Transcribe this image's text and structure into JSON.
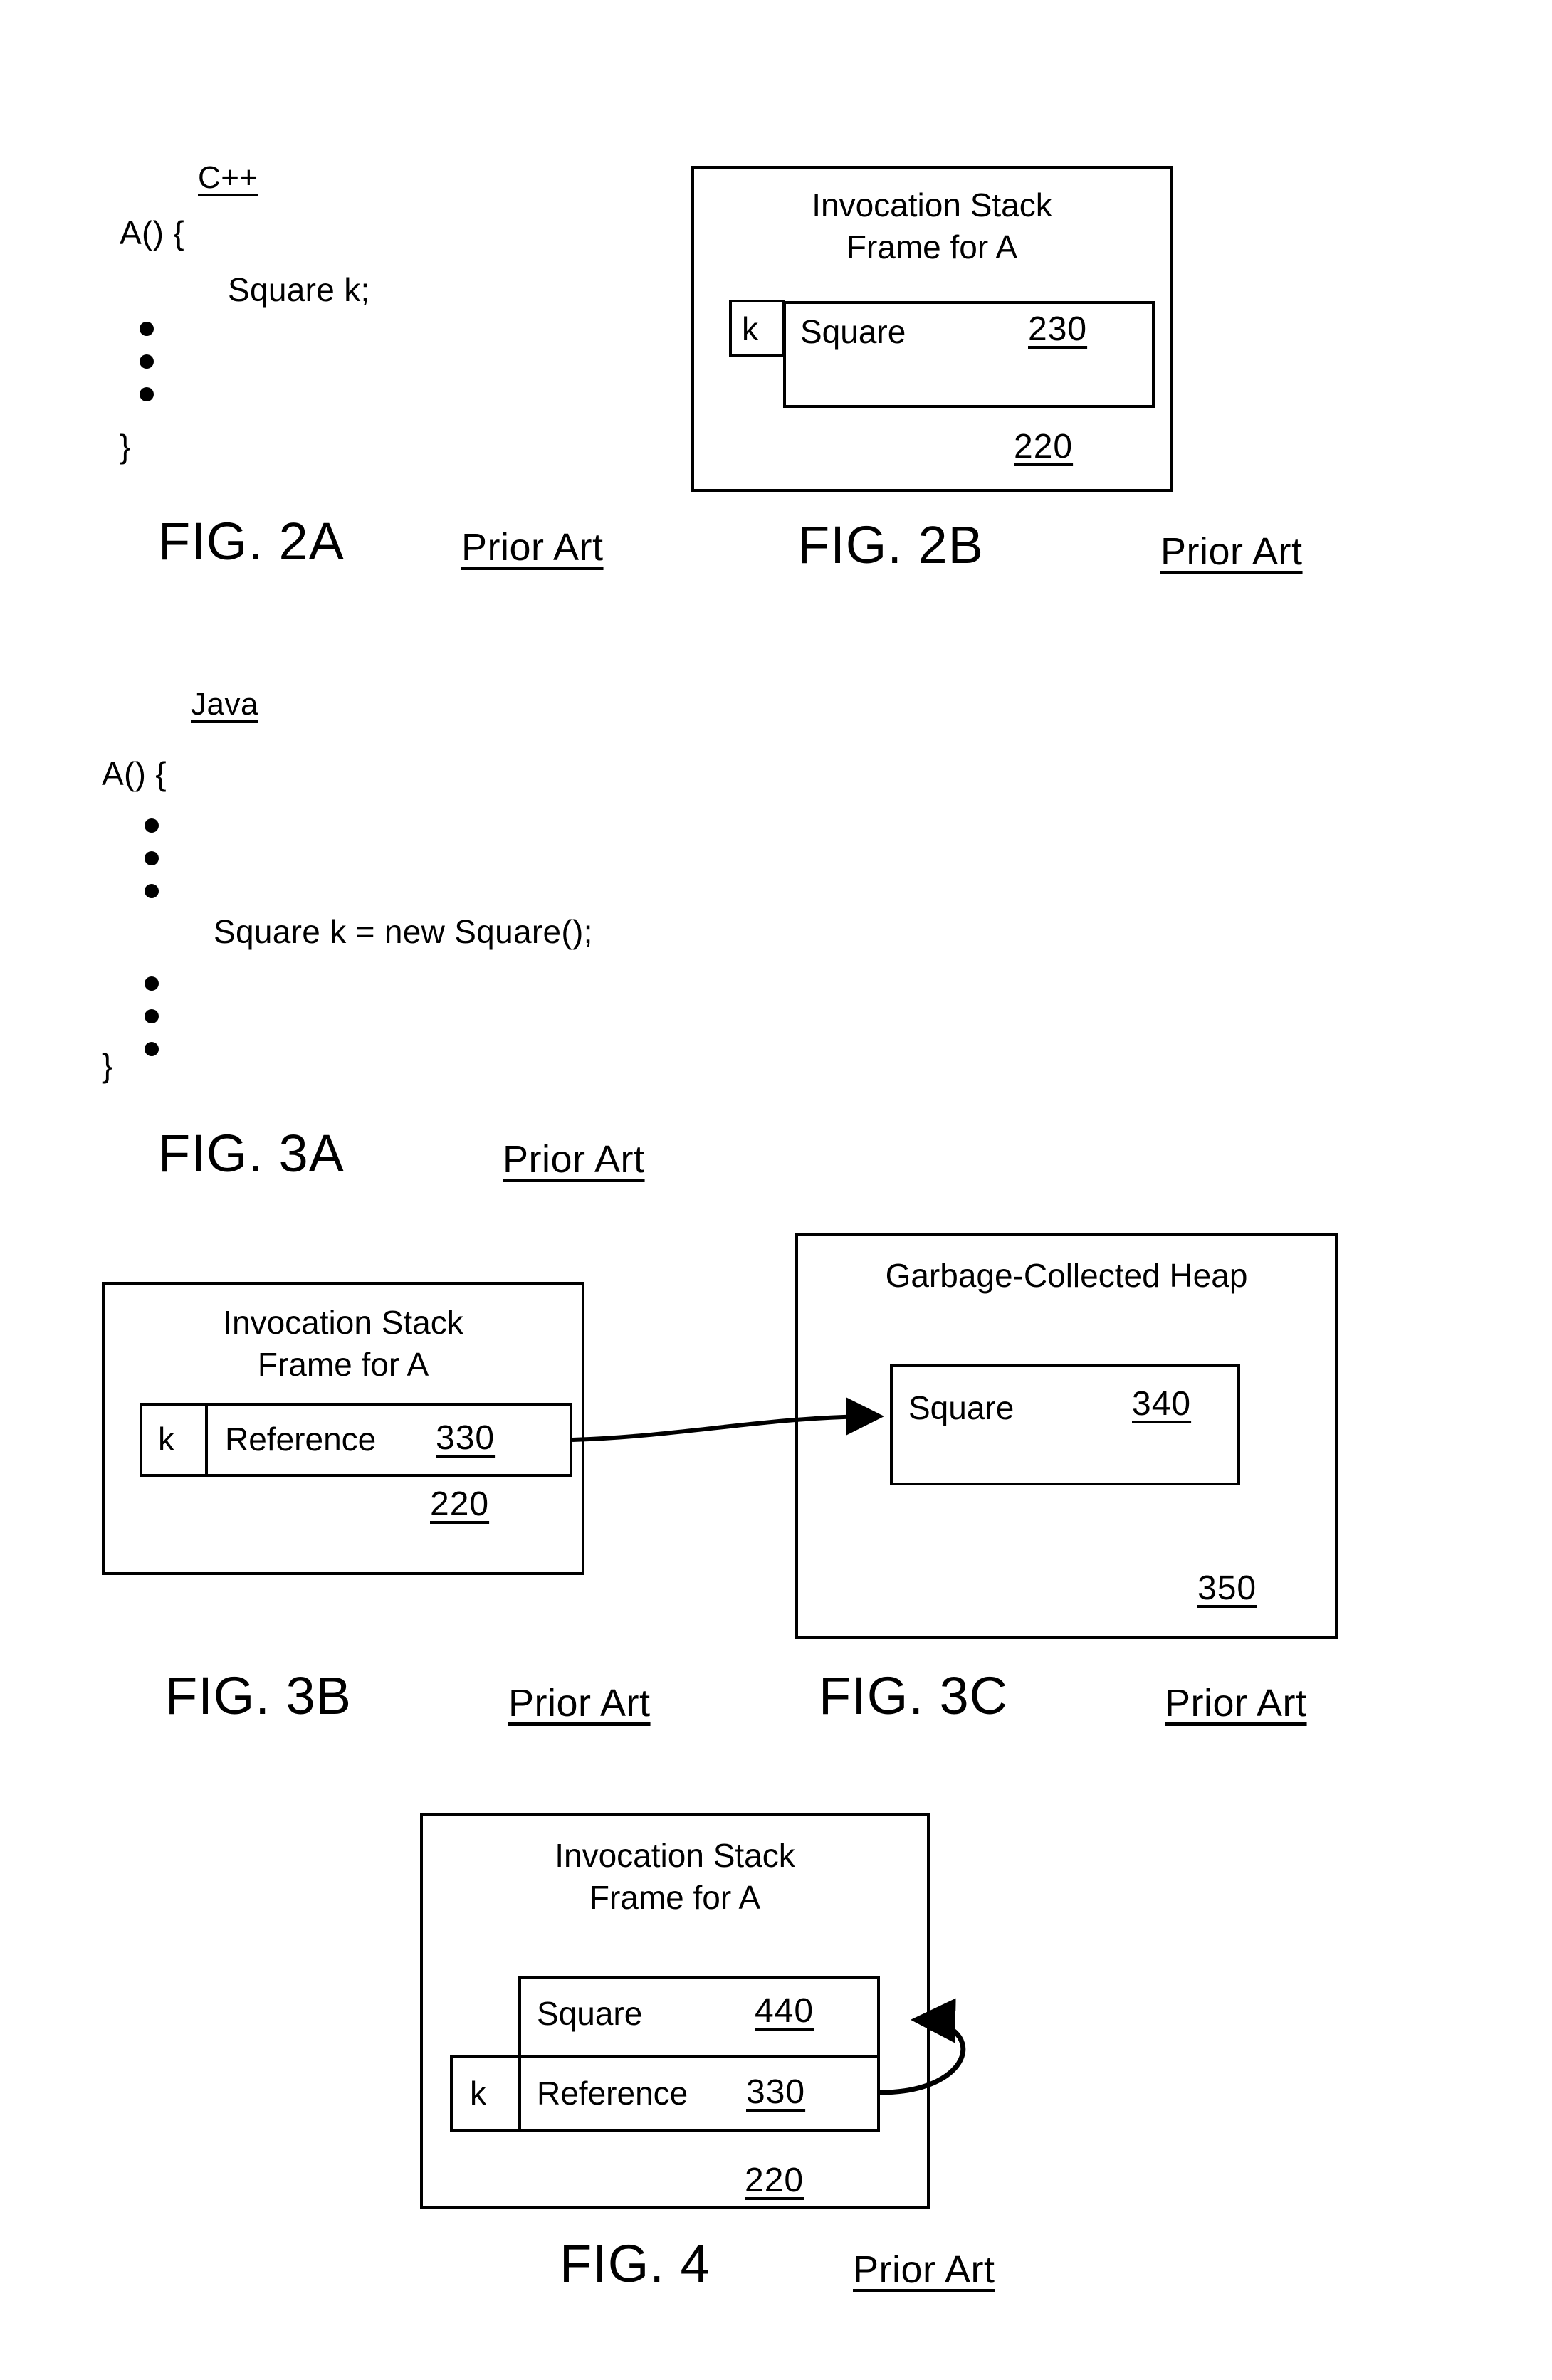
{
  "document": {
    "type": "patent-drawing-sheet",
    "figures": [
      "FIG. 2A",
      "FIG. 2B",
      "FIG. 3A",
      "FIG. 3B",
      "FIG. 3C",
      "FIG. 4"
    ],
    "prior_art_note": "Prior Art"
  },
  "fig2a": {
    "language_heading": "C++",
    "code": {
      "line1": "A() {",
      "line2": "Square k;",
      "line3": "}"
    },
    "caption": "FIG. 2A",
    "prior_art": "Prior Art"
  },
  "fig2b": {
    "title_line1": "Invocation Stack",
    "title_line2": "Frame for A",
    "var_label": "k",
    "slot_type": "Square",
    "slot_ref": "230",
    "frame_ref": "220",
    "caption": "FIG. 2B",
    "prior_art": "Prior Art"
  },
  "fig3a": {
    "language_heading": "Java",
    "code": {
      "line1": "A() {",
      "line2": "Square k = new Square();",
      "line3": "}"
    },
    "caption": "FIG. 3A",
    "prior_art": "Prior Art"
  },
  "fig3b": {
    "title_line1": "Invocation Stack",
    "title_line2": "Frame for A",
    "var_label": "k",
    "slot_type": "Reference",
    "slot_ref": "330",
    "frame_ref": "220",
    "caption": "FIG. 3B",
    "prior_art": "Prior Art"
  },
  "fig3c": {
    "title": "Garbage-Collected Heap",
    "object_type": "Square",
    "object_ref": "340",
    "heap_ref": "350",
    "caption": "FIG. 3C",
    "prior_art": "Prior Art"
  },
  "fig4": {
    "title_line1": "Invocation Stack",
    "title_line2": "Frame for A",
    "object_type": "Square",
    "object_ref": "440",
    "var_label": "k",
    "slot_type": "Reference",
    "slot_ref": "330",
    "frame_ref": "220",
    "caption": "FIG. 4",
    "prior_art": "Prior Art"
  },
  "colors": {
    "ink": "#000000",
    "paper": "#ffffff"
  }
}
